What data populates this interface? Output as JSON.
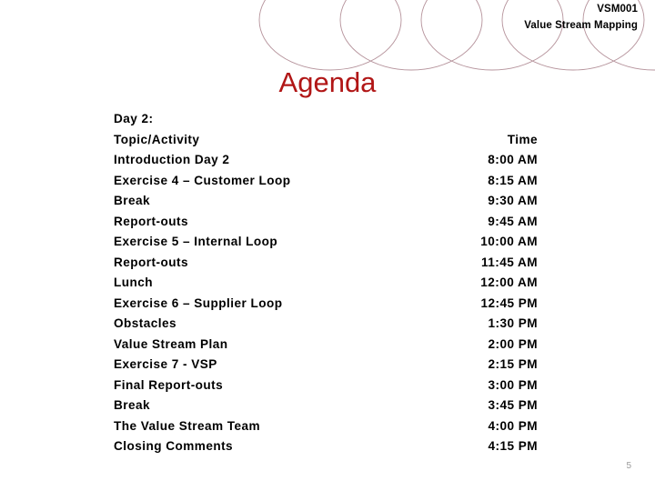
{
  "header": {
    "code": "VSM001",
    "course": "Value Stream Mapping"
  },
  "title": "Agenda",
  "colors": {
    "title_red": "#B11616",
    "body_text": "#000000",
    "circle_outline": "#A9808A",
    "page_number": "#9a9a9a"
  },
  "agenda": {
    "rows": [
      {
        "activity": "Day 2:",
        "time": ""
      },
      {
        "activity": "Topic/Activity",
        "time": "Time"
      },
      {
        "activity": "Introduction Day 2",
        "time": "8:00 AM"
      },
      {
        "activity": "Exercise 4 – Customer Loop",
        "time": "8:15 AM"
      },
      {
        "activity": "Break",
        "time": "9:30 AM"
      },
      {
        "activity": "Report-outs",
        "time": "9:45 AM"
      },
      {
        "activity": "Exercise 5 – Internal Loop",
        "time": "10:00 AM"
      },
      {
        "activity": "Report-outs",
        "time": "11:45 AM"
      },
      {
        "activity": "Lunch",
        "time": "12:00 AM"
      },
      {
        "activity": "Exercise 6 – Supplier Loop",
        "time": "12:45 PM"
      },
      {
        "activity": "Obstacles",
        "time": "1:30 PM"
      },
      {
        "activity": "Value Stream Plan",
        "time": "2:00 PM"
      },
      {
        "activity": "Exercise 7  - VSP",
        "time": "2:15 PM"
      },
      {
        "activity": "Final Report-outs",
        "time": "3:00 PM"
      },
      {
        "activity": "Break",
        "time": "3:45 PM"
      },
      {
        "activity": "The Value Stream Team",
        "time": "4:00 PM"
      },
      {
        "activity": "Closing Comments",
        "time": "4:15 PM"
      }
    ]
  },
  "page_number": "5"
}
